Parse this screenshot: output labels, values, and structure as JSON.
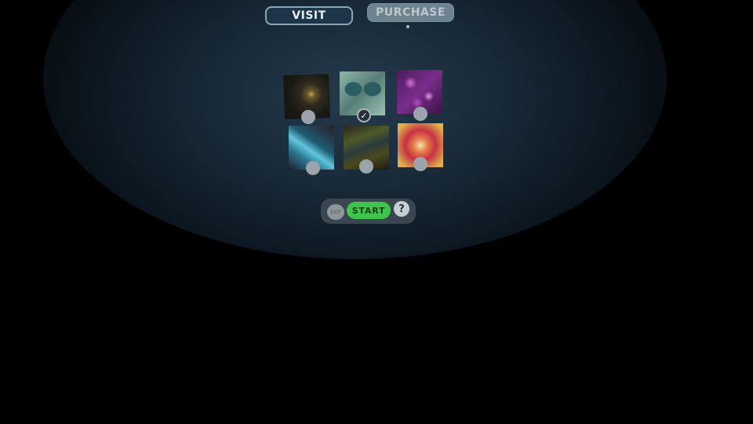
{
  "tabs": {
    "visit": "VISIT",
    "purchase": "PURCHASE"
  },
  "gallery": {
    "items": [
      {
        "name": "golden-star-burst",
        "selected": false
      },
      {
        "name": "teal-symmetry",
        "selected": true,
        "check": "✓"
      },
      {
        "name": "purple-crystals",
        "selected": false
      },
      {
        "name": "cyan-swirl",
        "selected": false
      },
      {
        "name": "tangled-fibers",
        "selected": false
      },
      {
        "name": "red-kaleidoscope",
        "selected": false
      }
    ]
  },
  "controls": {
    "exit": "EXIT",
    "start": "START",
    "help": "?"
  },
  "colors": {
    "start": "#3cc64a",
    "selected_ring": "#a9b4ba"
  }
}
